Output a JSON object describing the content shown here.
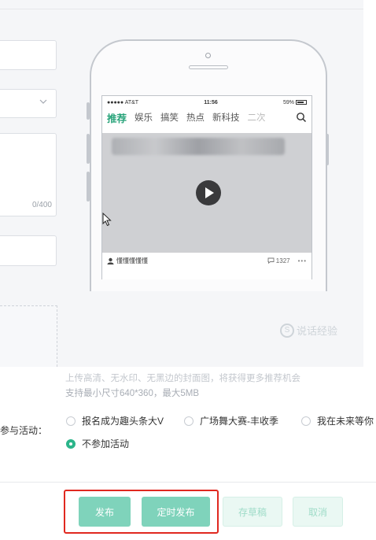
{
  "form": {
    "description_count": "0/400"
  },
  "preview": {
    "status_bar": {
      "carrier": "●●●●● AT&T",
      "time": "11:56",
      "battery": "59%"
    },
    "tabs": [
      "推荐",
      "娱乐",
      "搞笑",
      "热点",
      "新科技",
      "二次"
    ],
    "video": {
      "author": "懂懂懂懂懂",
      "comment_count": "1327",
      "more": "•••"
    }
  },
  "watermark": "说话经验",
  "cover_hint": {
    "line1": "上传高清、无水印、无黑边的封面图，将获得更多推荐机会",
    "line2": "支持最小尺寸640*360，最大5MB"
  },
  "activity": {
    "label": "参与活动：",
    "options": [
      {
        "label": "报名成为趣头条大V",
        "checked": false
      },
      {
        "label": "广场舞大赛-丰收季",
        "checked": false
      },
      {
        "label": "我在未来等你",
        "checked": false
      },
      {
        "label": "不参加活动",
        "checked": true
      }
    ]
  },
  "actions": {
    "publish": "发布",
    "schedule": "定时发布",
    "draft": "存草稿",
    "cancel": "取消"
  },
  "colors": {
    "accent": "#2bb58a",
    "highlight": "#e0281f"
  }
}
